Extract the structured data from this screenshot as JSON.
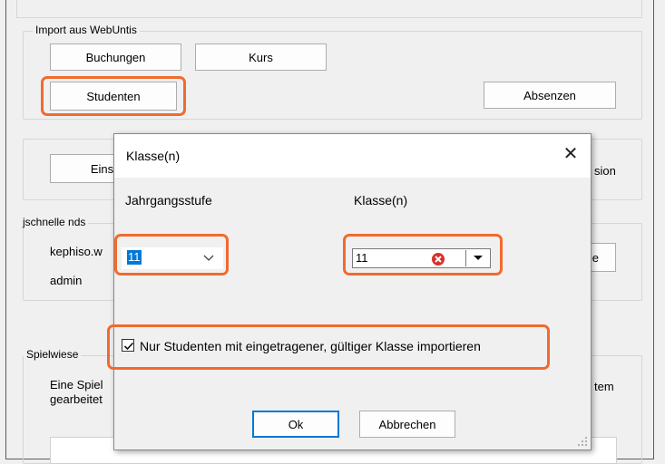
{
  "main": {
    "import_group_title": "Import aus WebUntis",
    "btn_buchungen": "Buchungen",
    "btn_kurs": "Kurs",
    "btn_studenten": "Studenten",
    "btn_absenzen": "Absenzen",
    "btn_einstellungen_partial": "Einste",
    "version_partial": "sion",
    "conn_group_title_partial": "jschnelle nds",
    "host_partial": "kephiso.w",
    "user_label": "admin",
    "btn_partial_le": "le",
    "spielwiese_title": "Spielwiese",
    "spielwiese_line1_left": "Eine Spiel",
    "spielwiese_line1_right": "tem",
    "spielwiese_line2_left": "gearbeitet"
  },
  "dialog": {
    "title": "Klasse(n)",
    "close_glyph": "✕",
    "label_jahrgangsstufe": "Jahrgangsstufe",
    "label_klassen": "Klasse(n)",
    "jahrgangsstufe_value": "11",
    "klasse_value": "11",
    "checkbox_label": "Nur Studenten mit eingetragener, gültiger Klasse importieren",
    "checkbox_checked": true,
    "ok_label": "Ok",
    "cancel_label": "Abbrechen"
  },
  "colors": {
    "highlight": "#f26a2e",
    "selection": "#0078d7",
    "clear_icon": "#d9302c"
  }
}
